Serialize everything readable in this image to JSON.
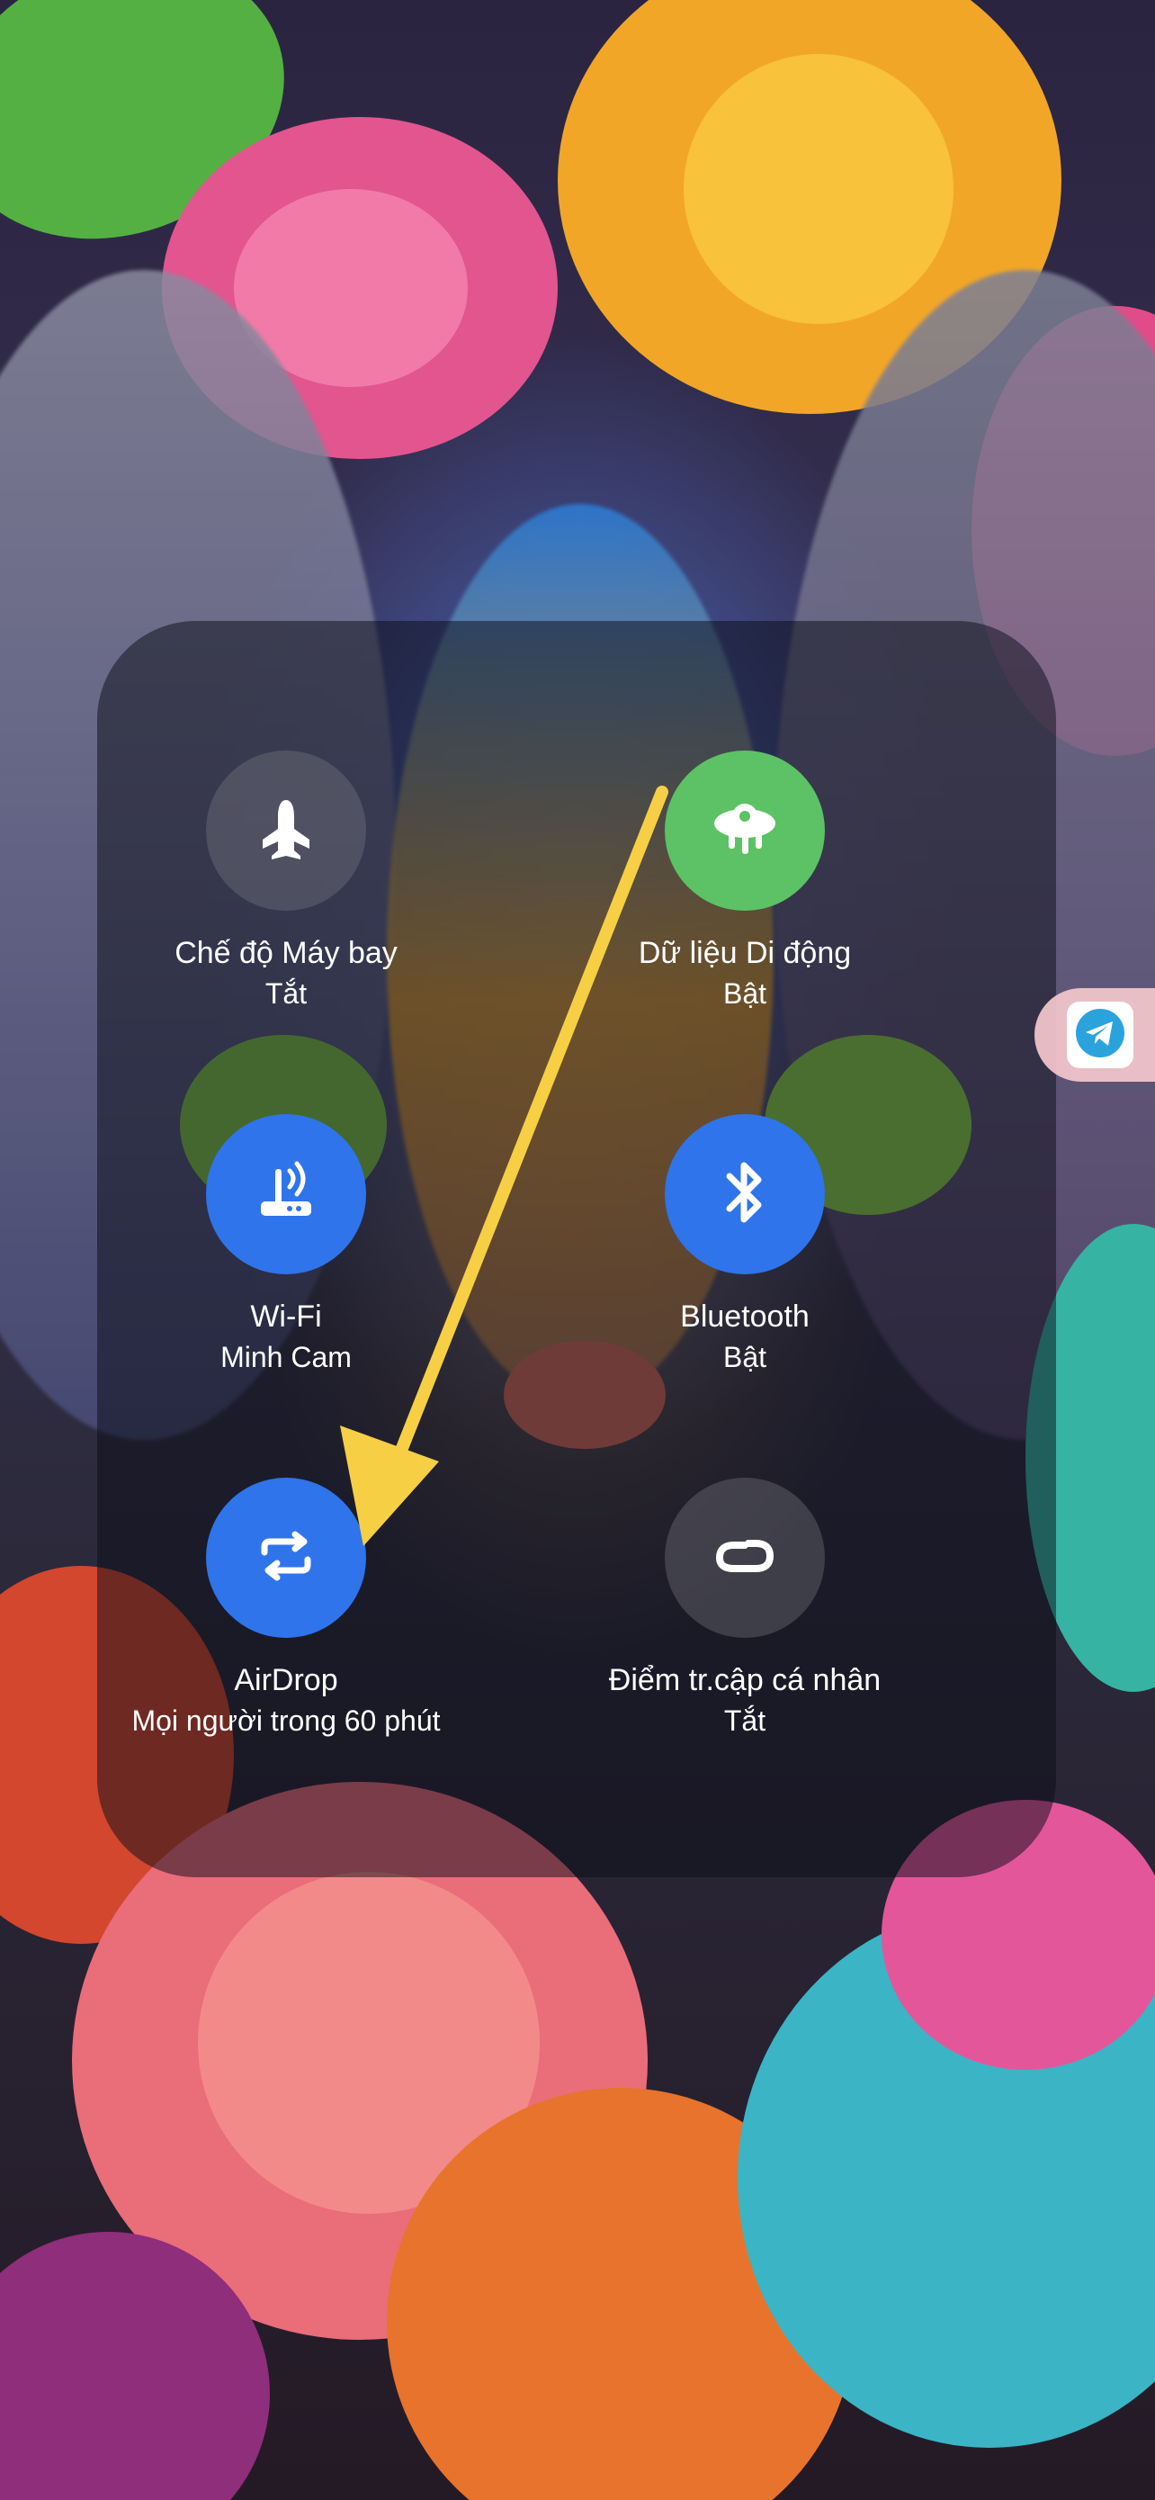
{
  "tiles": [
    {
      "id": "airplane",
      "label": "Chế độ Máy bay",
      "status": "Tắt",
      "icon": "airplane-mode-icon",
      "state_color": "#6e6e78"
    },
    {
      "id": "cellular",
      "label": "Dữ liệu Di động",
      "status": "Bật",
      "icon": "cellular-data-icon",
      "state_color": "#5cc265"
    },
    {
      "id": "wifi",
      "label": "Wi-Fi",
      "status": "Minh Cam",
      "icon": "wifi-router-icon",
      "state_color": "#2f74ea"
    },
    {
      "id": "bluetooth",
      "label": "Bluetooth",
      "status": "Bật",
      "icon": "bluetooth-icon",
      "state_color": "#2f74ea"
    },
    {
      "id": "airdrop",
      "label": "AirDrop",
      "status": "Mọi người trong 60 phút",
      "icon": "airdrop-icon",
      "state_color": "#2f74ea"
    },
    {
      "id": "hotspot",
      "label": "Điểm tr.cập cá nhân",
      "status": "Tắt",
      "icon": "personal-hotspot-icon",
      "state_color": "#6e6e78"
    }
  ],
  "edge_shortcut": {
    "icon": "telegram-icon",
    "color": "#2aa3dd"
  },
  "annotation": {
    "icon": "annotation-arrow-icon",
    "color": "#f7cf45"
  }
}
